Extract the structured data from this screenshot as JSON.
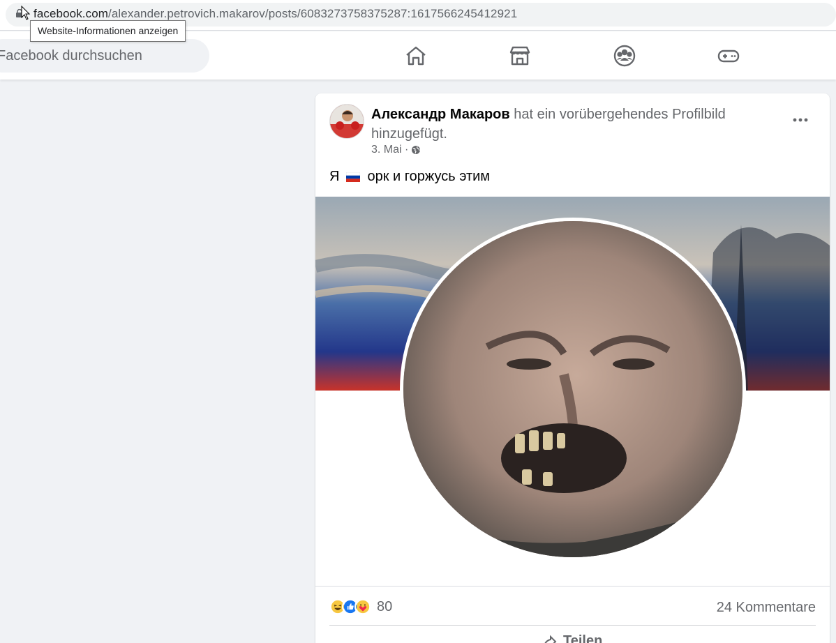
{
  "browser": {
    "url_host": "facebook.com",
    "url_path": "/alexander.petrovich.makarov/posts/6083273758375287:1617566245412921",
    "tooltip": "Website-Informationen anzeigen"
  },
  "fbnav": {
    "search_placeholder": "Facebook durchsuchen",
    "icons": [
      "home-icon",
      "marketplace-icon",
      "groups-icon",
      "gaming-icon"
    ]
  },
  "post": {
    "author": "Александр Макаров",
    "action": " hat ein vorübergehendes Profilbild hinzugefügt.",
    "date": "3. Mai · ",
    "text_before": "Я",
    "text_after": "орк и горжусь этим",
    "reaction_count": "80",
    "comments": "24 Kommentare",
    "share_label": "Teilen"
  },
  "colors": {
    "flag_white": "#ffffff",
    "flag_blue": "#0039a6",
    "flag_red": "#d52b1e",
    "facebook_bg": "#f0f2f5"
  }
}
